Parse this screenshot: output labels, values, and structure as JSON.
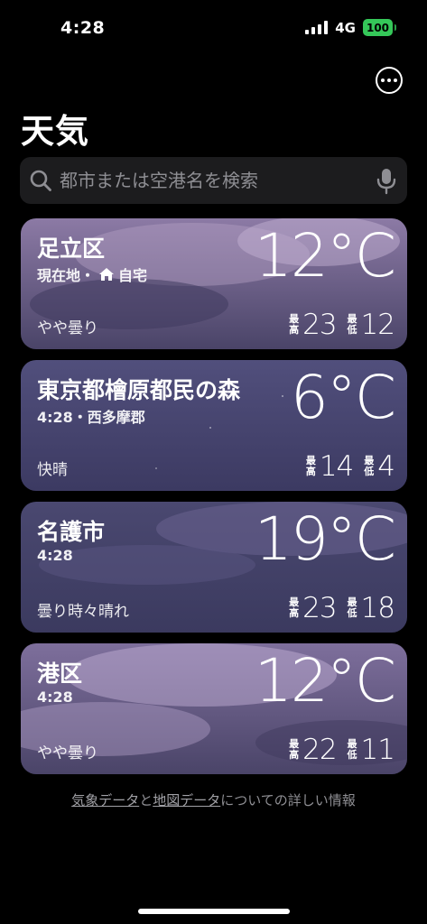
{
  "status_bar": {
    "time": "4:28",
    "network": "4G",
    "battery": "100"
  },
  "header": {
    "title": "天気",
    "more_icon": "ellipsis-circle-icon"
  },
  "search": {
    "placeholder": "都市または空港名を検索",
    "value": "",
    "icon": "search-icon",
    "mic_icon": "mic-icon"
  },
  "labels": {
    "high": "最高",
    "low": "最低"
  },
  "cities": [
    {
      "name": "足立区",
      "sub_prefix": "現在地・",
      "sub_icon": "home-icon",
      "sub_suffix": "自宅",
      "temp": "12°C",
      "condition": "やや曇り",
      "high": "23",
      "low": "12"
    },
    {
      "name": "東京都檜原都民の森",
      "sub": "4:28・西多摩郡",
      "temp": "6°C",
      "condition": "快晴",
      "high": "14",
      "low": "4"
    },
    {
      "name": "名護市",
      "sub": "4:28",
      "temp": "19°C",
      "condition": "曇り時々晴れ",
      "high": "23",
      "low": "18"
    },
    {
      "name": "港区",
      "sub": "4:28",
      "temp": "12°C",
      "condition": "やや曇り",
      "high": "22",
      "low": "11"
    }
  ],
  "footer": {
    "link1": "気象データ",
    "and": "と",
    "link2": "地図データ",
    "rest": "についての詳しい情報"
  }
}
